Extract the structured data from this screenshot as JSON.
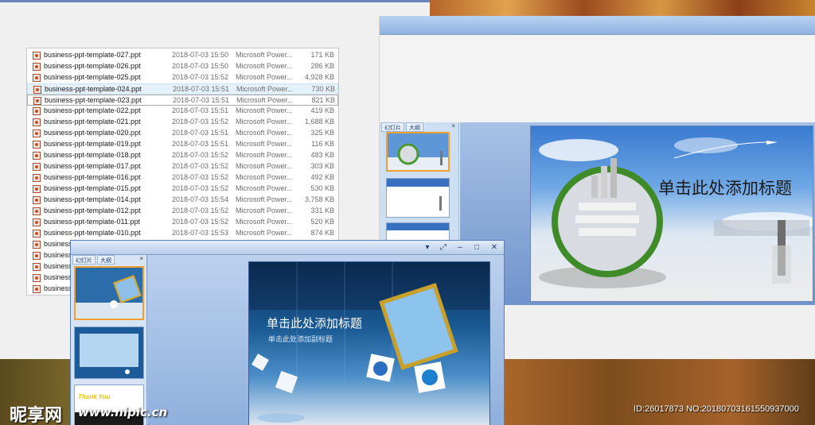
{
  "watermark": {
    "logo": "昵享网",
    "site": "www.nipic.cn",
    "id_text": "ID:26017873 NO:20180703161550937000"
  },
  "file_list": {
    "rows": [
      {
        "name": "business-ppt-template-027.ppt",
        "date": "2018-07-03 15:50",
        "type": "Microsoft Power...",
        "size": "171 KB"
      },
      {
        "name": "business-ppt-template-026.ppt",
        "date": "2018-07-03 15:50",
        "type": "Microsoft Power...",
        "size": "286 KB"
      },
      {
        "name": "business-ppt-template-025.ppt",
        "date": "2018-07-03 15:52",
        "type": "Microsoft Power...",
        "size": "4,928 KB"
      },
      {
        "name": "business-ppt-template-024.ppt",
        "date": "2018-07-03 15:51",
        "type": "Microsoft Power...",
        "size": "730 KB"
      },
      {
        "name": "business-ppt-template-023.ppt",
        "date": "2018-07-03 15:51",
        "type": "Microsoft Power...",
        "size": "821 KB"
      },
      {
        "name": "business-ppt-template-022.ppt",
        "date": "2018-07-03 15:51",
        "type": "Microsoft Power...",
        "size": "419 KB"
      },
      {
        "name": "business-ppt-template-021.ppt",
        "date": "2018-07-03 15:52",
        "type": "Microsoft Power...",
        "size": "1,688 KB"
      },
      {
        "name": "business-ppt-template-020.ppt",
        "date": "2018-07-03 15:51",
        "type": "Microsoft Power...",
        "size": "325 KB"
      },
      {
        "name": "business-ppt-template-019.ppt",
        "date": "2018-07-03 15:51",
        "type": "Microsoft Power...",
        "size": "116 KB"
      },
      {
        "name": "business-ppt-template-018.ppt",
        "date": "2018-07-03 15:52",
        "type": "Microsoft Power...",
        "size": "483 KB"
      },
      {
        "name": "business-ppt-template-017.ppt",
        "date": "2018-07-03 15:52",
        "type": "Microsoft Power...",
        "size": "303 KB"
      },
      {
        "name": "business-ppt-template-016.ppt",
        "date": "2018-07-03 15:52",
        "type": "Microsoft Power...",
        "size": "492 KB"
      },
      {
        "name": "business-ppt-template-015.ppt",
        "date": "2018-07-03 15:52",
        "type": "Microsoft Power...",
        "size": "530 KB"
      },
      {
        "name": "business-ppt-template-014.ppt",
        "date": "2018-07-03 15:54",
        "type": "Microsoft Power...",
        "size": "3,758 KB"
      },
      {
        "name": "business-ppt-template-012.ppt",
        "date": "2018-07-03 15:52",
        "type": "Microsoft Power...",
        "size": "331 KB"
      },
      {
        "name": "business-ppt-template-011.ppt",
        "date": "2018-07-03 15:52",
        "type": "Microsoft Power...",
        "size": "520 KB"
      },
      {
        "name": "business-ppt-template-010.ppt",
        "date": "2018-07-03 15:53",
        "type": "Microsoft Power...",
        "size": "874 KB"
      },
      {
        "name": "business",
        "date": "",
        "type": "",
        "size": ""
      },
      {
        "name": "business",
        "date": "",
        "type": "",
        "size": ""
      },
      {
        "name": "business",
        "date": "",
        "type": "",
        "size": ""
      },
      {
        "name": "business",
        "date": "",
        "type": "",
        "size": ""
      },
      {
        "name": "business",
        "date": "",
        "type": "",
        "size": ""
      }
    ]
  },
  "right_ppt": {
    "pane_tabs": [
      "幻灯片",
      "大纲"
    ],
    "pane_close": "×",
    "slide_title": "单击此处添加标题"
  },
  "front_ppt": {
    "pane_tabs": [
      "幻灯片",
      "大纲"
    ],
    "pane_close": "×",
    "window_buttons": {
      "dropdown": "▾",
      "resize": "⤢",
      "minimize": "–",
      "maximize": "□",
      "close": "✕"
    },
    "slide_title": "单击此处添加标题",
    "slide_subtitle": "单击此处添加副标题",
    "thumb3_text": "Thank You"
  }
}
